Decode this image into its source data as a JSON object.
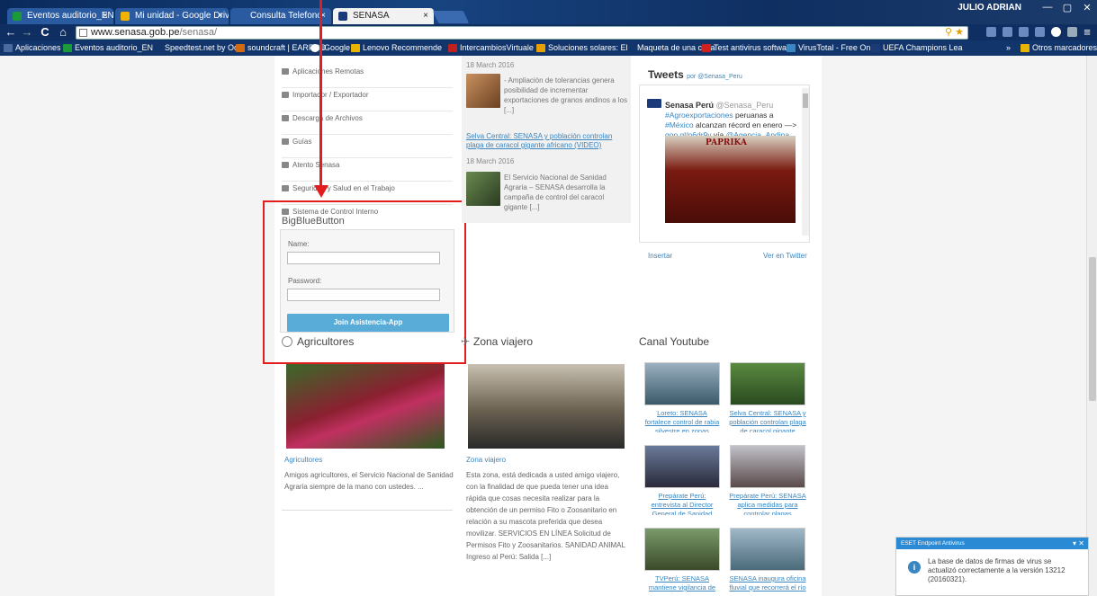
{
  "browser": {
    "tabs": [
      {
        "label": "Eventos auditorio_ENERO",
        "favicon_color": "#1a9a3a"
      },
      {
        "label": "Mi unidad - Google Drive",
        "favicon_color": "#f0b400"
      },
      {
        "label": "Consulta Telefono",
        "favicon_color": "#3a6ab0"
      },
      {
        "label": "SENASA",
        "favicon_color": "#ffffff"
      }
    ],
    "tab_close": "×",
    "user_name": "JULIO ADRIAN",
    "window_buttons": [
      "—",
      "▢",
      "✕"
    ],
    "nav": {
      "back": "←",
      "forward": "→",
      "reload": "C",
      "home": "⌂"
    },
    "url": {
      "domain": "www.senasa.gob.pe",
      "path": "/senasa/"
    },
    "bookmarks": [
      {
        "label": "Aplicaciones",
        "color": "#4a6aa0"
      },
      {
        "label": "Eventos auditorio_EN",
        "color": "#1a9a3a"
      },
      {
        "label": "Speedtest.net by Ook",
        "color": "#4a6aa0"
      },
      {
        "label": "soundcraft | EARPRO",
        "color": "#d06a10"
      },
      {
        "label": "iGoogle",
        "color": "#ffffff"
      },
      {
        "label": "Lenovo Recommende",
        "color": "#e8b400"
      },
      {
        "label": "IntercambiosVirtuale",
        "color": "#c02020"
      },
      {
        "label": "Soluciones solares: El",
        "color": "#e8a000"
      },
      {
        "label": "Maqueta de una casa",
        "color": "#4a6aa0"
      },
      {
        "label": "Test antivirus softwar",
        "color": "#d02020"
      },
      {
        "label": "VirusTotal - Free Onli",
        "color": "#3a86c0"
      },
      {
        "label": "UEFA Champions Lea",
        "color": "#1a3a7a"
      }
    ],
    "bookmarks_more": "»",
    "other_bookmarks": "Otros marcadores"
  },
  "sidebar_menu": [
    {
      "label": "Aplicaciones Remotas"
    },
    {
      "label": "Importador / Exportador"
    },
    {
      "label": "Descarga de Archivos"
    },
    {
      "label": "Guías"
    },
    {
      "label": "Atento Senasa"
    },
    {
      "label": "Seguridad y Salud en el Trabajo"
    },
    {
      "label": "Sistema de Control Interno"
    }
  ],
  "bigbluebutton": {
    "title": "BigBlueButton",
    "name_label": "Name:",
    "password_label": "Password:",
    "join_button": "Join Asistencia-App"
  },
  "news": [
    {
      "date": "18 March 2016",
      "title": "",
      "text": "- Ampliación de tolerancias genera posibilidad de incrementar exportaciones de granos andinos a los [...]"
    },
    {
      "date": "18 March 2016",
      "title": "Selva Central: SENASA y población controlan plaga de caracol gigante africano (VIDEO)",
      "text": "El Servicio Nacional de Sanidad Agraria – SENASA desarrolla la campaña de control del caracol gigante [...]"
    }
  ],
  "tweets": {
    "heading": "Tweets",
    "by": "por @Senasa_Peru",
    "author": "Senasa Perú",
    "handle": "@Senasa_Peru",
    "text_parts": [
      "#Agroexportaciones",
      " peruanas a ",
      "#México",
      " alcanzan récord en enero —> ",
      "goo.gl/p6dr9y",
      " vía ",
      "@Agencia_Andina"
    ],
    "image_label": "PAPRIKA",
    "insert": "Insertar",
    "view_on_twitter": "Ver en Twitter"
  },
  "sections": {
    "agricultores": {
      "title": "Agricultores",
      "caption_title": "Agricultores",
      "caption_text": "Amigos agricultores, el Servicio Nacional de Sanidad Agraria siempre de la mano con ustedes. ..."
    },
    "zona_viajero": {
      "title": "Zona viajero",
      "caption_title": "Zona viajero",
      "caption_text": "Esta zona, está dedicada a usted amigo viajero, con la finalidad de que pueda tener una idea rápida que cosas necesita realizar para la obtención de un permiso Fito o Zoosanitario en relación a su mascota preferida que desea movilizar. SERVICIOS EN LÍNEA Solicitud de Permisos Fito y Zoosanitarios. SANIDAD ANIMAL Ingreso al Perú: Salida [...]"
    },
    "youtube": {
      "title": "Canal Youtube",
      "videos": [
        {
          "caption": "Loreto: SENASA fortalece control de rabia silvestre en zonas rurales..."
        },
        {
          "caption": "Selva Central: SENASA y población controlan plaga de caracol gigante"
        },
        {
          "caption": "Prepárate Perú: entrevista al Director General de Sanidad Animal del"
        },
        {
          "caption": "Prepárate Perú: SENASA aplica medidas para controlar plagas"
        },
        {
          "caption": "TVPerú: SENASA mantiene vigilancia de plagas en"
        },
        {
          "caption": "SENASA inaugura oficina fluvial que recorrerá el río"
        }
      ]
    }
  },
  "eset": {
    "title": "ESET Endpoint Antivirus",
    "close": "▾ ✕",
    "message": "La base de datos de firmas de virus se actualizó correctamente a la versión 13212 (20160321)."
  },
  "annotation_color": "#e21d1d"
}
